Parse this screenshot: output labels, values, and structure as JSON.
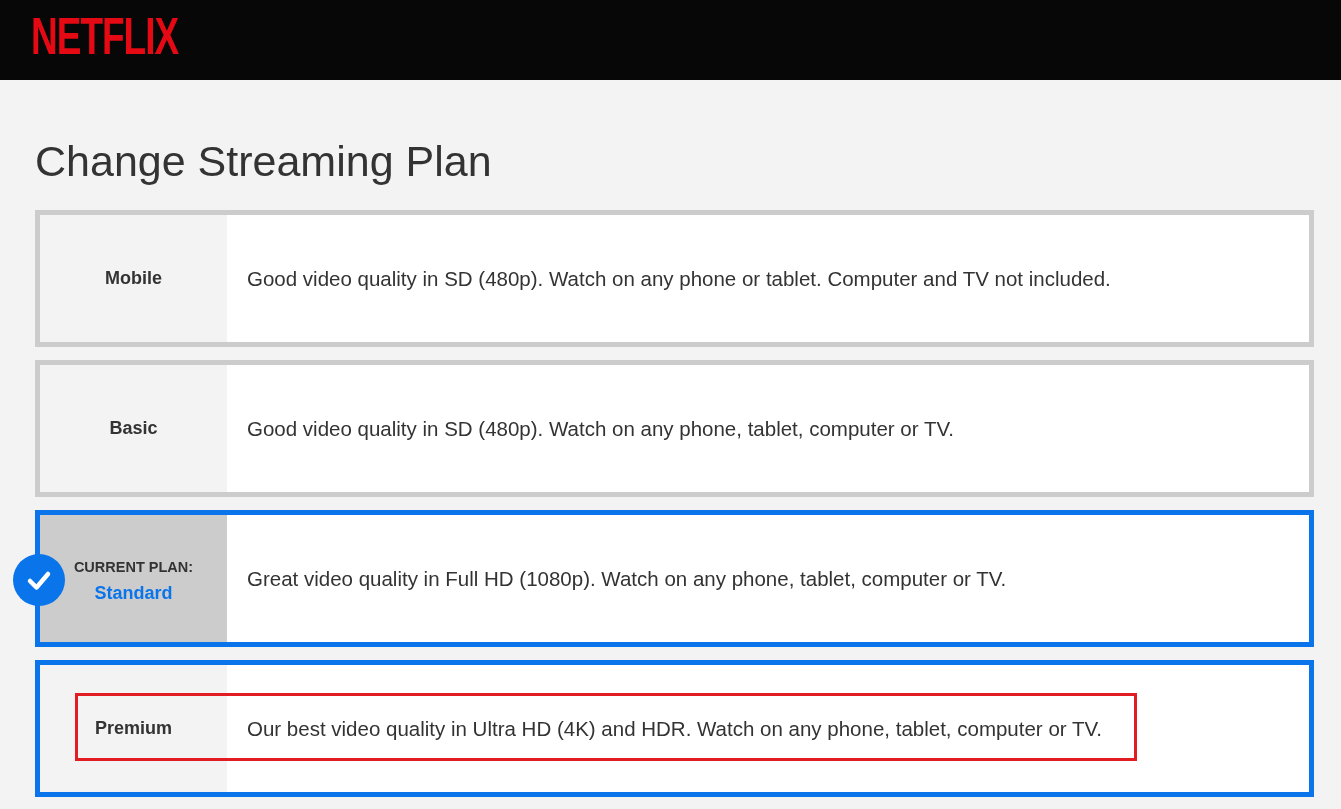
{
  "header": {
    "logo": "NETFLIX"
  },
  "title": "Change Streaming Plan",
  "plans": [
    {
      "name": "Mobile",
      "description": "Good video quality in SD (480p). Watch on any phone or tablet. Computer and TV not included.",
      "selected": false,
      "current": false,
      "highlighted": false
    },
    {
      "name": "Basic",
      "description": "Good video quality in SD (480p). Watch on any phone, tablet, computer or TV.",
      "selected": false,
      "current": false,
      "highlighted": false
    },
    {
      "name": "Standard",
      "badge": "CURRENT PLAN:",
      "description": "Great video quality in Full HD (1080p). Watch on any phone, tablet, computer or TV.",
      "selected": true,
      "current": true,
      "highlighted": false
    },
    {
      "name": "Premium",
      "description": "Our best video quality in Ultra HD (4K) and HDR. Watch on any phone, tablet, computer or TV.",
      "selected": true,
      "current": false,
      "highlighted": true
    }
  ]
}
